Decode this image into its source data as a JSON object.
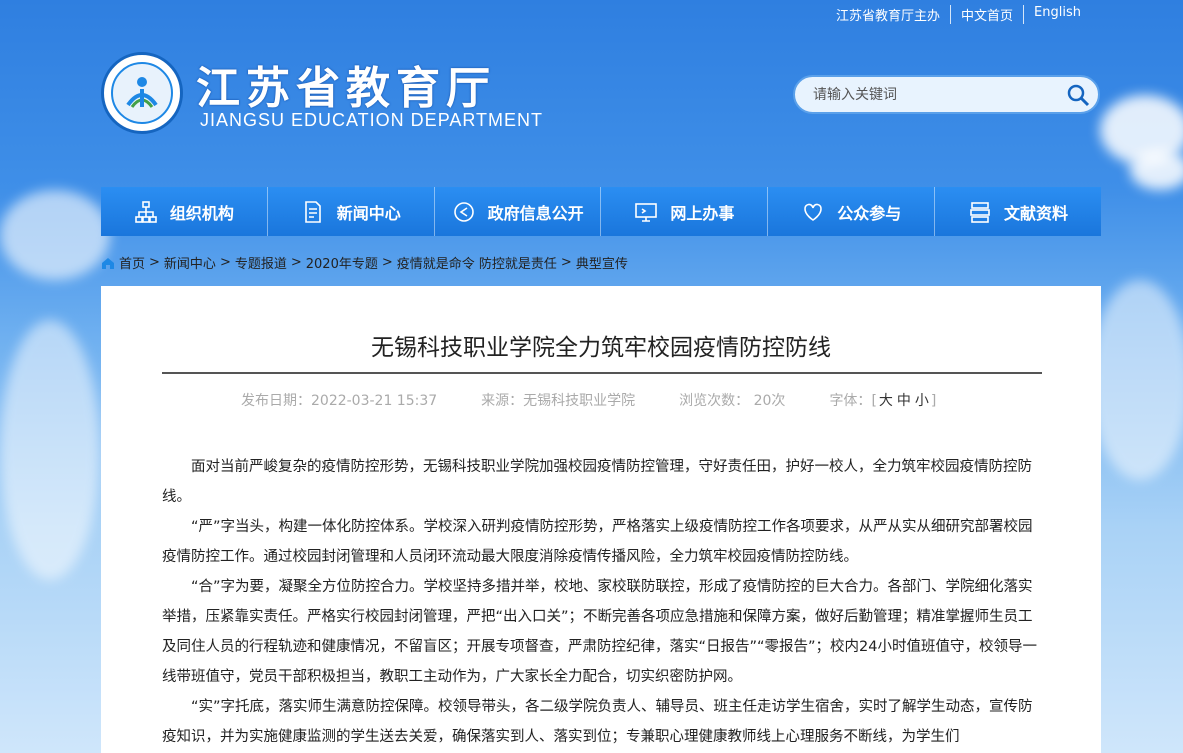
{
  "top_links": [
    "江苏省教育厅主办",
    "中文首页",
    "English"
  ],
  "site": {
    "title": "江苏省教育厅",
    "subtitle": "JIANGSU EDUCATION DEPARTMENT"
  },
  "search": {
    "placeholder": "请输入关键词"
  },
  "nav": [
    {
      "label": "组织机构",
      "icon": "org-chart-icon"
    },
    {
      "label": "新闻中心",
      "icon": "document-icon"
    },
    {
      "label": "政府信息公开",
      "icon": "send-icon"
    },
    {
      "label": "网上办事",
      "icon": "monitor-icon"
    },
    {
      "label": "公众参与",
      "icon": "heart-icon"
    },
    {
      "label": "文献资料",
      "icon": "books-icon"
    }
  ],
  "breadcrumb": [
    "首页",
    "新闻中心",
    "专题报道",
    "2020年专题",
    "疫情就是命令 防控就是责任",
    "典型宣传"
  ],
  "article": {
    "title": "无锡科技职业学院全力筑牢校园疫情防控防线",
    "meta": {
      "date": "发布日期：2022-03-21 15:37",
      "source": "来源：无锡科技职业学院",
      "views": "浏览次数：  20次",
      "font_label": "字体：",
      "font_sizes": [
        "大",
        "中",
        "小"
      ]
    },
    "paragraphs": [
      "面对当前严峻复杂的疫情防控形势，无锡科技职业学院加强校园疫情防控管理，守好责任田，护好一校人，全力筑牢校园疫情防控防线。",
      "“严”字当头，构建一体化防控体系。学校深入研判疫情防控形势，严格落实上级疫情防控工作各项要求，从严从实从细研究部署校园疫情防控工作。通过校园封闭管理和人员闭环流动最大限度消除疫情传播风险，全力筑牢校园疫情防控防线。",
      "“合”字为要，凝聚全方位防控合力。学校坚持多措并举，校地、家校联防联控，形成了疫情防控的巨大合力。各部门、学院细化落实举措，压紧靠实责任。严格实行校园封闭管理，严把“出入口关”；不断完善各项应急措施和保障方案，做好后勤管理；精准掌握师生员工及同住人员的行程轨迹和健康情况，不留盲区；开展专项督查，严肃防控纪律，落实“日报告”“零报告”；校内24小时值班值守，校领导一线带班值守，党员干部积极担当，教职工主动作为，广大家长全力配合，切实织密防护网。",
      "“实”字托底，落实师生满意防控保障。校领导带头，各二级学院负责人、辅导员、班主任走访学生宿舍，实时了解学生动态，宣传防疫知识，并为实施健康监测的学生送去关爱，确保落实到人、落实到位；专兼职心理健康教师线上心理服务不断线，为学生们"
    ]
  },
  "colors": {
    "nav_bg": "#1a76dc",
    "header_text": "#ffffff"
  }
}
